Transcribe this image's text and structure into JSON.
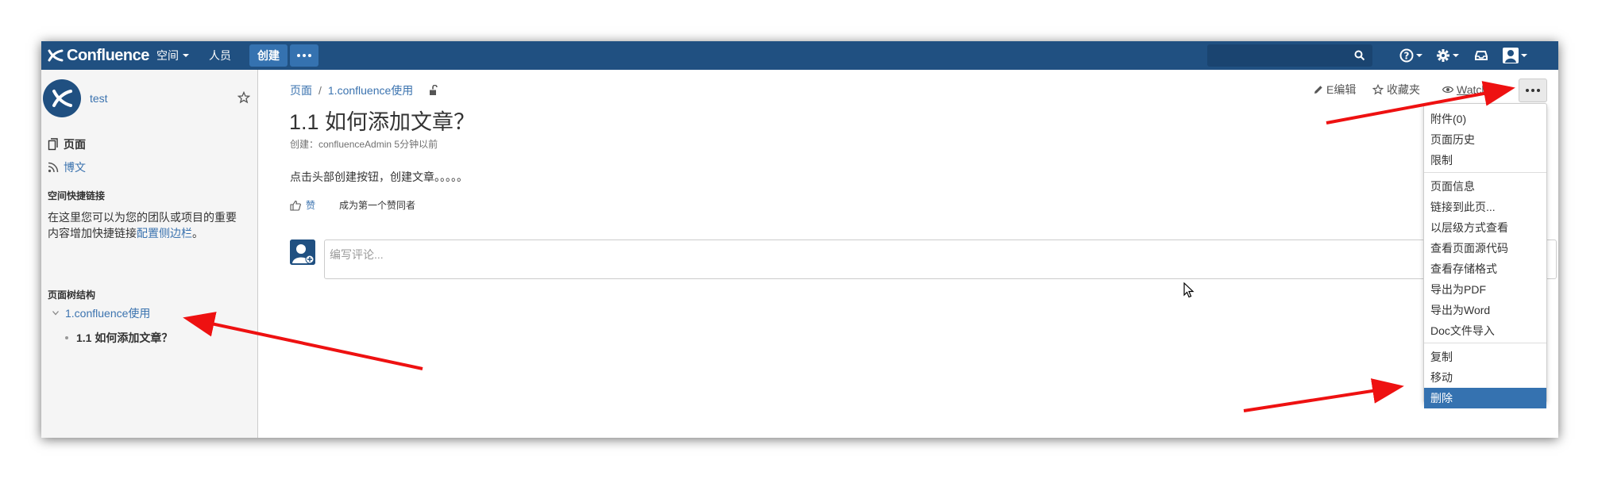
{
  "header": {
    "app_name": "Confluence",
    "nav_spaces": "空间",
    "nav_people": "人员",
    "create_label": "创建",
    "search_placeholder": "",
    "brand_color": "#205081",
    "accent_color": "#3572b0",
    "icons": [
      "confluence-logo-icon",
      "more-dots-icon",
      "search-icon",
      "help-icon",
      "settings-icon",
      "notifications-icon",
      "user-icon"
    ]
  },
  "sidebar": {
    "space_name": "test",
    "pages_label": "页面",
    "blog_label": "博文",
    "shortcuts_heading": "空间快捷链接",
    "shortcuts_help_text": "在这里您可以为您的团队或项目的重要内容增加快捷链接",
    "shortcuts_help_link": "配置侧边栏",
    "shortcuts_help_suffix": "。",
    "tree_heading": "页面树结构",
    "tree_root": "1.confluence使用",
    "tree_child": "1.1 如何添加文章？"
  },
  "page": {
    "breadcrumb": [
      "页面",
      "/",
      "1.confluence使用"
    ],
    "title": "1.1 如何添加文章？",
    "meta": "创建：confluenceAdmin 5分钟以前",
    "body": "点击头部创建按钮，创建文章。。。。。",
    "like_label": "赞",
    "like_first": "成为第一个赞同者",
    "comment_placeholder": "编写评论..."
  },
  "toolbar": {
    "edit_label": "E编辑",
    "favourite_label": "收藏夹",
    "watching_label": "Watching"
  },
  "more_menu": {
    "sections": [
      [
        "附件(0)",
        "页面历史",
        "限制"
      ],
      [
        "页面信息",
        "链接到此页...",
        "以层级方式查看",
        "查看页面源代码",
        "查看存储格式",
        "导出为PDF",
        "导出为Word",
        "Doc文件导入"
      ],
      [
        "复制",
        "移动",
        "删除"
      ]
    ],
    "highlighted": "删除"
  },
  "annotation_color": "#ee1111"
}
